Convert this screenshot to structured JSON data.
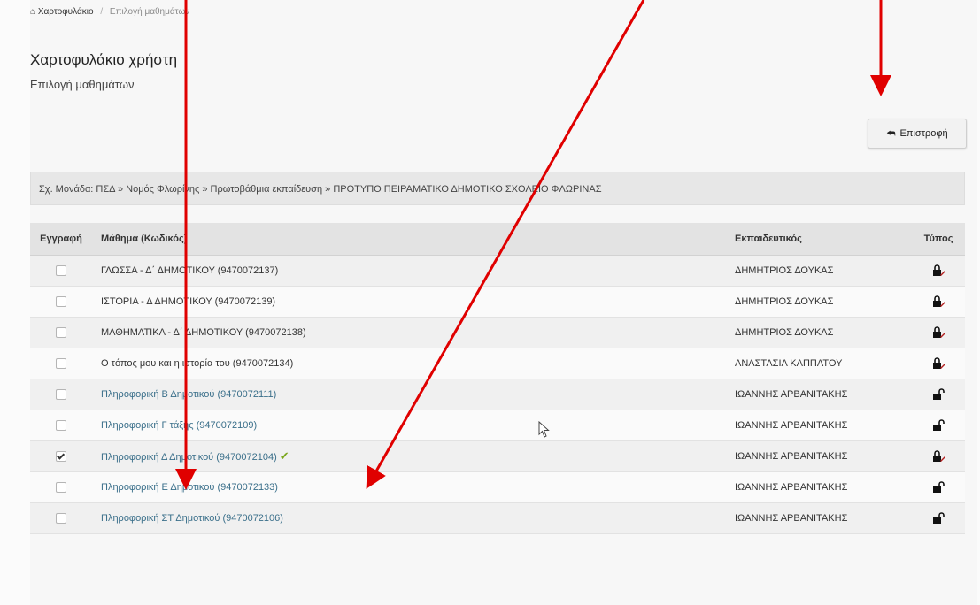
{
  "breadcrumb": {
    "home": "Χαρτοφυλάκιο",
    "separator": "/",
    "current": "Επιλογή μαθημάτων"
  },
  "header": {
    "title": "Χαρτοφυλάκιο χρήστη",
    "subtitle": "Επιλογή μαθημάτων"
  },
  "back_button": {
    "label": "Επιστροφή",
    "icon": "reply-icon"
  },
  "unit_path": "Σχ. Μονάδα: ΠΣΔ » Νομός Φλωρίνης » Πρωτοβάθμια εκπαίδευση » ΠΡΟΤΥΠΟ ΠΕΙΡΑΜΑΤΙΚΟ ΔΗΜΟΤΙΚΟ ΣΧΟΛΕΙΟ ΦΛΩΡΙΝΑΣ",
  "table": {
    "headers": {
      "registration": "Εγγραφή",
      "course": "Μάθημα (Κωδικός)",
      "teacher": "Εκπαιδευτικός",
      "type": "Τύπος"
    },
    "rows": [
      {
        "course": "ΓΛΩΣΣΑ - Δ΄ ΔΗΜΟΤΙΚΟΥ (9470072137)",
        "teacher": "ΔΗΜΗΤΡΙΟΣ ΔΟΥΚΑΣ",
        "checked": false,
        "link": false,
        "lock": "locked",
        "tick": false
      },
      {
        "course": "ΙΣΤΟΡΙΑ - Δ ΔΗΜΟΤΙΚΟΥ (9470072139)",
        "teacher": "ΔΗΜΗΤΡΙΟΣ ΔΟΥΚΑΣ",
        "checked": false,
        "link": false,
        "lock": "locked",
        "tick": false
      },
      {
        "course": "ΜΑΘΗΜΑΤΙΚΑ - Δ΄ ΔΗΜΟΤΙΚΟΥ (9470072138)",
        "teacher": "ΔΗΜΗΤΡΙΟΣ ΔΟΥΚΑΣ",
        "checked": false,
        "link": false,
        "lock": "locked",
        "tick": false
      },
      {
        "course": "Ο τόπος μου και η ιστορία του (9470072134)",
        "teacher": "ΑΝΑΣΤΑΣΙΑ ΚΑΠΠΑΤΟΥ",
        "checked": false,
        "link": false,
        "lock": "locked",
        "tick": false
      },
      {
        "course": "Πληροφορική Β Δημοτικού (9470072111)",
        "teacher": "ΙΩΑΝΝΗΣ ΑΡΒΑΝΙΤΑΚΗΣ",
        "checked": false,
        "link": true,
        "lock": "unlocked",
        "tick": false
      },
      {
        "course": "Πληροφορική Γ τάξης (9470072109)",
        "teacher": "ΙΩΑΝΝΗΣ ΑΡΒΑΝΙΤΑΚΗΣ",
        "checked": false,
        "link": true,
        "lock": "unlocked",
        "tick": false
      },
      {
        "course": "Πληροφορική Δ Δημοτικού (9470072104)",
        "teacher": "ΙΩΑΝΝΗΣ ΑΡΒΑΝΙΤΑΚΗΣ",
        "checked": true,
        "link": true,
        "lock": "locked",
        "tick": true
      },
      {
        "course": "Πληροφορική Ε Δημοτικού (9470072133)",
        "teacher": "ΙΩΑΝΝΗΣ ΑΡΒΑΝΙΤΑΚΗΣ",
        "checked": false,
        "link": true,
        "lock": "unlocked",
        "tick": false
      },
      {
        "course": "Πληροφορική ΣΤ Δημοτικού (9470072106)",
        "teacher": "ΙΩΑΝΝΗΣ ΑΡΒΑΝΙΤΑΚΗΣ",
        "checked": false,
        "link": true,
        "lock": "unlocked",
        "tick": false
      }
    ]
  },
  "colors": {
    "link": "#3a6f8a",
    "tick": "#7aa61a",
    "annotation_arrow": "#e00000"
  }
}
